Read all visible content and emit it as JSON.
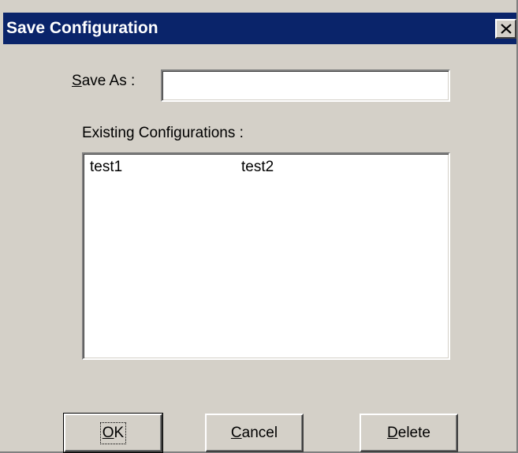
{
  "window": {
    "title": "Save Configuration",
    "close_icon": "close-icon"
  },
  "form": {
    "save_as_label": "Save As :",
    "save_as_value": "",
    "existing_label": "Existing Configurations :",
    "configurations": [
      "test1",
      "test2"
    ]
  },
  "buttons": {
    "ok": "OK",
    "cancel": "Cancel",
    "delete": "Delete"
  },
  "colors": {
    "titlebar": "#0a246a",
    "face": "#d4d0c8",
    "field": "#ffffff"
  }
}
